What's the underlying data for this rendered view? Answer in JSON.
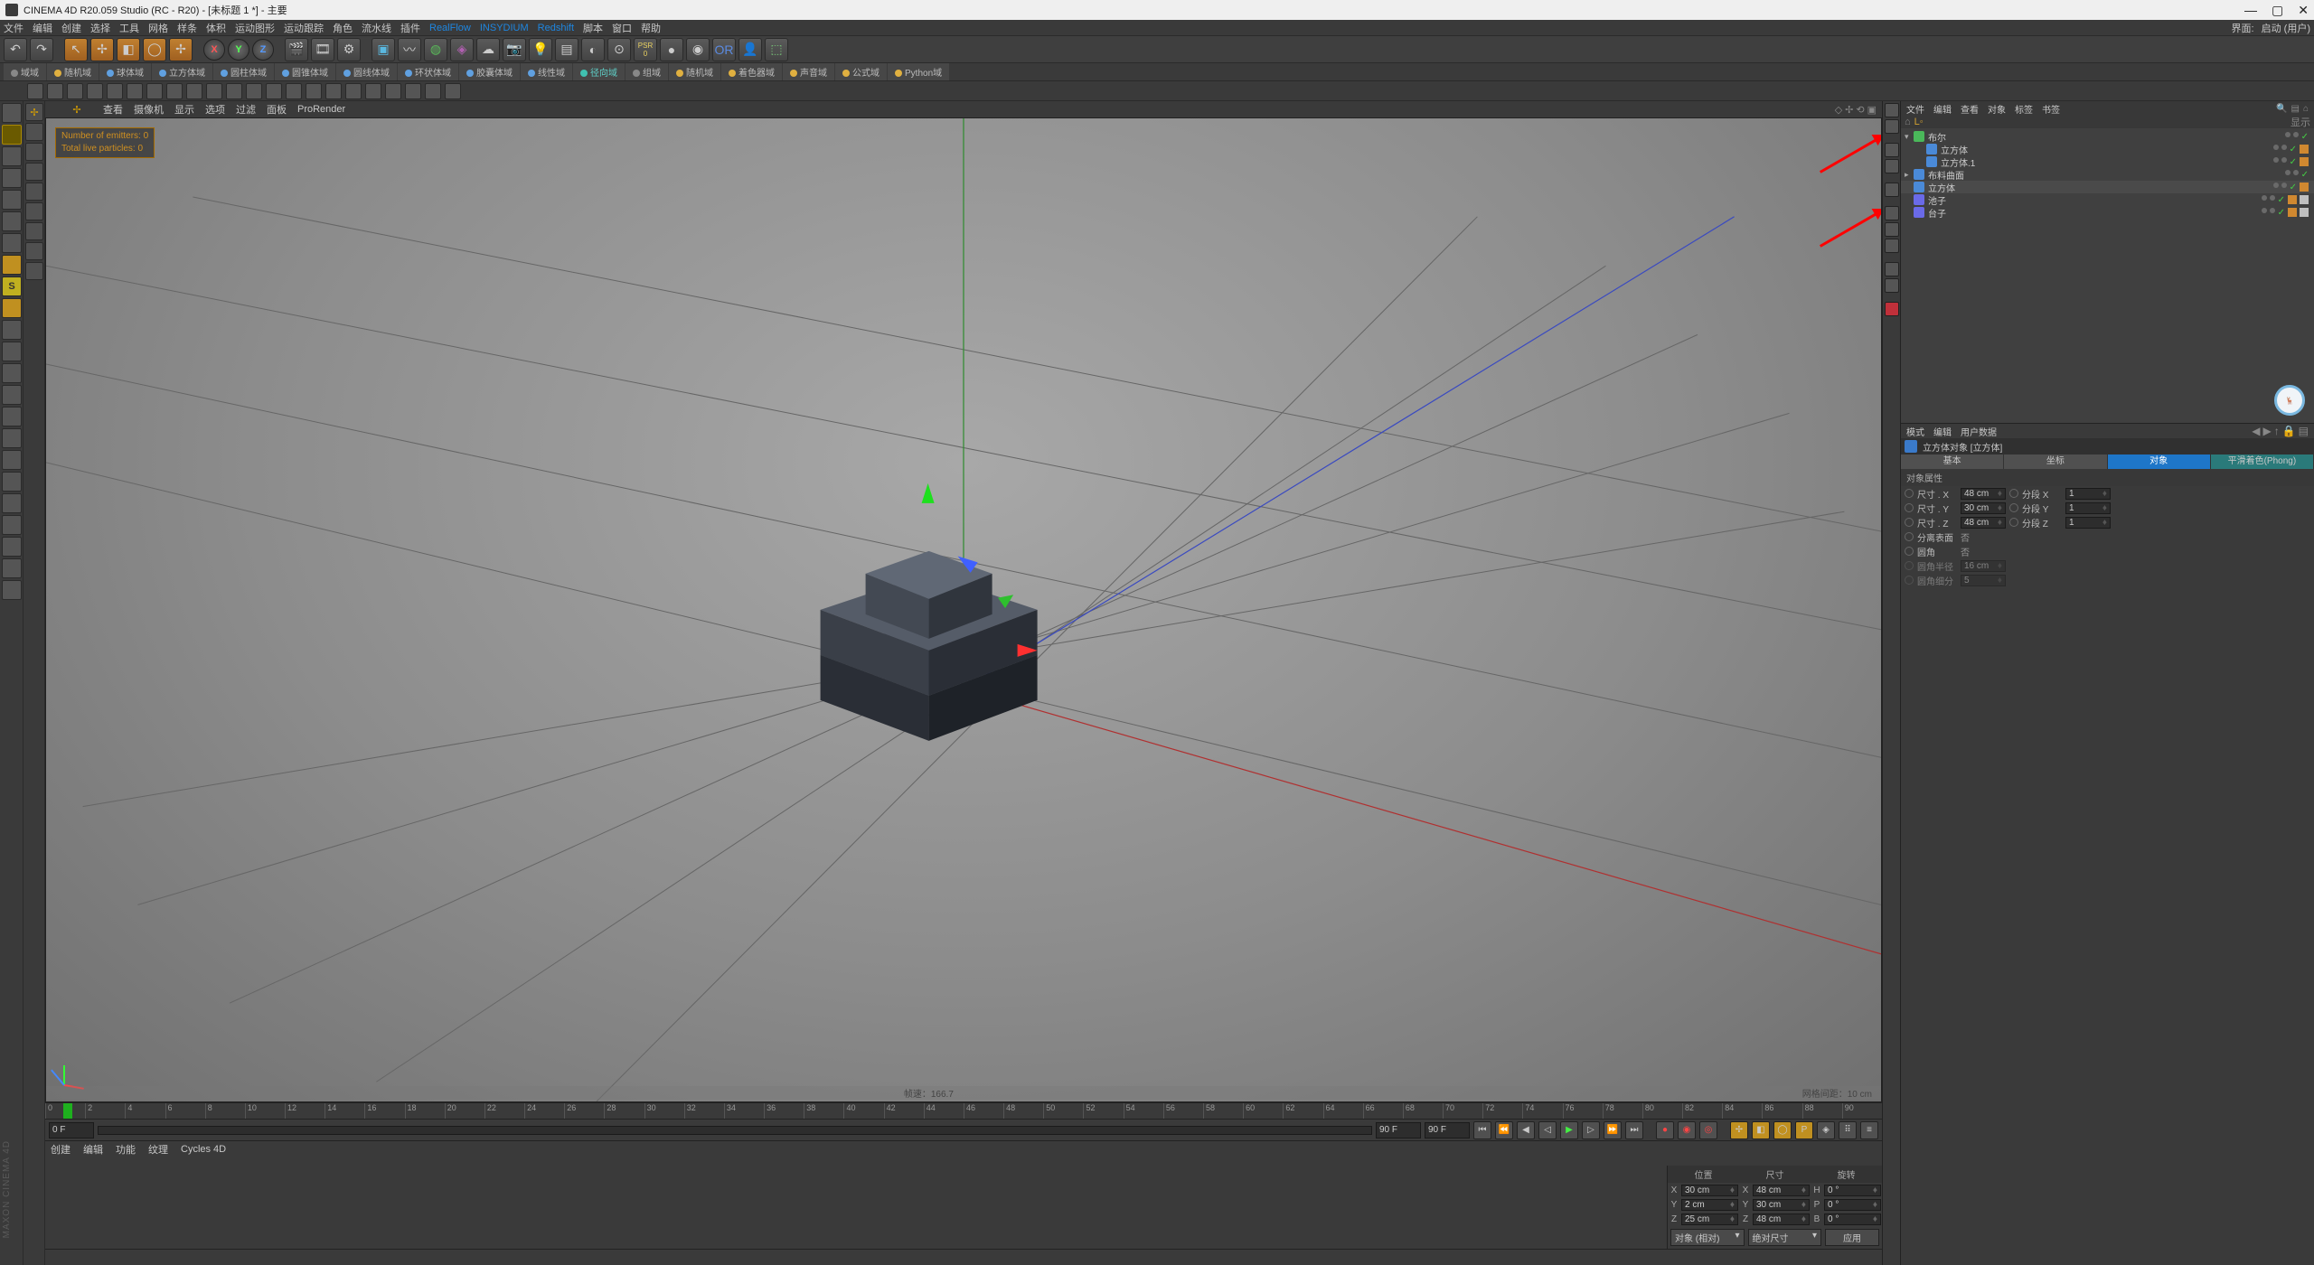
{
  "window": {
    "title": "CINEMA 4D R20.059 Studio (RC - R20) - [未标题 1 *] - 主要",
    "watermark": "MAXON CINEMA 4D"
  },
  "menubar": {
    "items": [
      "文件",
      "编辑",
      "创建",
      "选择",
      "工具",
      "网格",
      "样条",
      "体积",
      "运动图形",
      "运动跟踪",
      "角色",
      "流水线",
      "插件"
    ],
    "plugins": [
      "RealFlow",
      "INSYDIUM",
      "Redshift"
    ],
    "items2": [
      "脚本",
      "窗口",
      "帮助"
    ],
    "right_label": "界面:",
    "right_value": "启动 (用户)"
  },
  "fieldstabs": [
    "域域",
    "随机域",
    "球体域",
    "立方体域",
    "圆柱体域",
    "圆锥体域",
    "圆线体域",
    "环状体域",
    "胶囊体域",
    "线性域",
    "径向域",
    "组域",
    "随机域",
    "着色器域",
    "声音域",
    "公式域",
    "Python域"
  ],
  "viewportMenu": [
    "查看",
    "摄像机",
    "显示",
    "选项",
    "过滤",
    "面板",
    "ProRender"
  ],
  "overlay": {
    "emitters": "Number of emitters: 0",
    "particles": "Total live particles: 0"
  },
  "viewportStatus": {
    "fps_label": "帧速：",
    "fps": "166.7",
    "grid_label": "网格间距：",
    "grid": "10 cm"
  },
  "timeline": {
    "start": 0,
    "end": 90,
    "current": "0 F",
    "endField": "90 F"
  },
  "bottomMenu": [
    "创建",
    "编辑",
    "功能",
    "纹理",
    "Cycles 4D"
  ],
  "coord": {
    "headers": [
      "位置",
      "尺寸",
      "旋转"
    ],
    "rows": [
      {
        "axis": "X",
        "pos": "30 cm",
        "posLbl": "X",
        "size": "48 cm",
        "rotLbl": "H",
        "rot": "0 °"
      },
      {
        "axis": "Y",
        "pos": "2 cm",
        "posLbl": "Y",
        "size": "30 cm",
        "rotLbl": "P",
        "rot": "0 °"
      },
      {
        "axis": "Z",
        "pos": "25 cm",
        "posLbl": "Z",
        "size": "48 cm",
        "rotLbl": "B",
        "rot": "0 °"
      }
    ],
    "sel1": "对象 (相对)",
    "sel2": "绝对尺寸",
    "apply": "应用"
  },
  "objmgr": {
    "menu": [
      "文件",
      "编辑",
      "查看",
      "对象",
      "标签",
      "书签"
    ],
    "toprow": "显示",
    "tree": [
      {
        "indent": 0,
        "exp": "▾",
        "icon": "#4ab85a",
        "name": "布尔",
        "tags": [
          "vis",
          "vis"
        ],
        "extra": []
      },
      {
        "indent": 1,
        "exp": "",
        "icon": "#4a8ad8",
        "name": "立方体",
        "tags": [
          "vis",
          "vis"
        ],
        "extra": [
          "phong"
        ],
        "sel": false
      },
      {
        "indent": 1,
        "exp": "",
        "icon": "#4a8ad8",
        "name": "立方体.1",
        "tags": [
          "vis",
          "vis"
        ],
        "extra": [
          "phong"
        ],
        "sel": false
      },
      {
        "indent": 0,
        "exp": "▸",
        "icon": "#4a8ad8",
        "name": "布料曲面",
        "tags": [
          "vis",
          "vis"
        ],
        "extra": []
      },
      {
        "indent": 0,
        "exp": "",
        "icon": "#4a8ad8",
        "name": "立方体",
        "tags": [
          "vis",
          "vis"
        ],
        "extra": [
          "phong"
        ],
        "sel": true
      },
      {
        "indent": 0,
        "exp": "",
        "icon": "#6a6ae8",
        "name": "池子",
        "tags": [
          "vis",
          "vis"
        ],
        "extra": [
          "phong",
          "mat"
        ]
      },
      {
        "indent": 0,
        "exp": "",
        "icon": "#6a6ae8",
        "name": "台子",
        "tags": [
          "vis",
          "vis"
        ],
        "extra": [
          "phong",
          "mat"
        ]
      }
    ]
  },
  "attr": {
    "menu": [
      "模式",
      "编辑",
      "用户数据"
    ],
    "title": "立方体对象 [立方体]",
    "tabs": [
      "基本",
      "坐标",
      "对象",
      "平滑着色(Phong)"
    ],
    "activeTab": 2,
    "section": "对象属性",
    "props": [
      {
        "lbl": "尺寸 . X",
        "val": "48 cm",
        "lbl2": "分段 X",
        "val2": "1"
      },
      {
        "lbl": "尺寸 . Y",
        "val": "30 cm",
        "lbl2": "分段 Y",
        "val2": "1"
      },
      {
        "lbl": "尺寸 . Z",
        "val": "48 cm",
        "lbl2": "分段 Z",
        "val2": "1"
      }
    ],
    "checks": [
      {
        "lbl": "分离表面",
        "val": "否"
      },
      {
        "lbl": "圆角",
        "val": "否"
      }
    ],
    "dimmed": [
      {
        "lbl": "圆角半径",
        "val": "16 cm"
      },
      {
        "lbl": "圆角细分",
        "val": "5"
      }
    ]
  },
  "axis": {
    "x": "X",
    "y": "Y",
    "z": "Z"
  }
}
